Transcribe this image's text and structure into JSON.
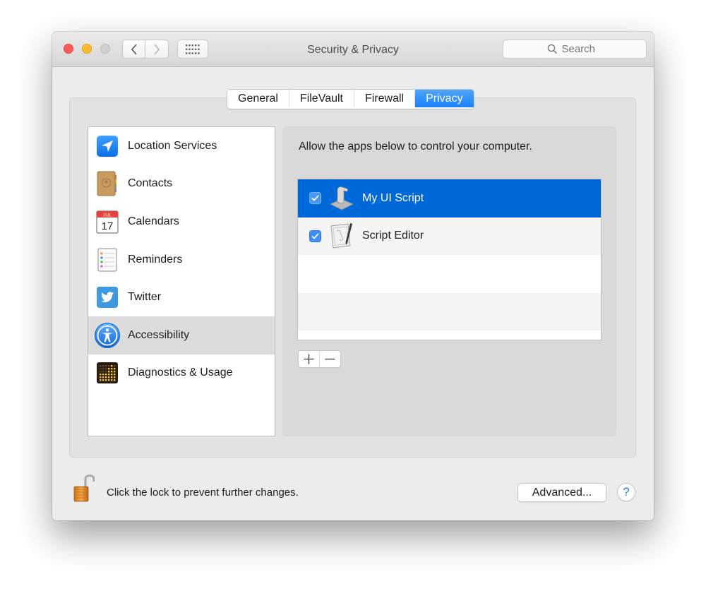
{
  "window": {
    "title": "Security & Privacy",
    "search_placeholder": "Search"
  },
  "tabs": [
    {
      "label": "General",
      "active": false
    },
    {
      "label": "FileVault",
      "active": false
    },
    {
      "label": "Firewall",
      "active": false
    },
    {
      "label": "Privacy",
      "active": true
    }
  ],
  "sidebar": {
    "items": [
      {
        "label": "Location Services",
        "icon": "location-arrow-icon",
        "selected": false
      },
      {
        "label": "Contacts",
        "icon": "contacts-book-icon",
        "selected": false
      },
      {
        "label": "Calendars",
        "icon": "calendar-icon",
        "selected": false,
        "icon_month": "JUL",
        "icon_day": "17"
      },
      {
        "label": "Reminders",
        "icon": "reminders-list-icon",
        "selected": false
      },
      {
        "label": "Twitter",
        "icon": "twitter-bird-icon",
        "selected": false
      },
      {
        "label": "Accessibility",
        "icon": "accessibility-figure-icon",
        "selected": true
      },
      {
        "label": "Diagnostics & Usage",
        "icon": "diagnostics-grid-icon",
        "selected": false
      }
    ]
  },
  "panel": {
    "description": "Allow the apps below to control your computer.",
    "apps": [
      {
        "name": "My UI Script",
        "checked": true,
        "selected": true,
        "icon": "script-scroll-icon"
      },
      {
        "name": "Script Editor",
        "checked": true,
        "selected": false,
        "icon": "script-editor-icon"
      }
    ],
    "add_label": "+",
    "remove_label": "−"
  },
  "footer": {
    "lock_text": "Click the lock to prevent further changes.",
    "lock_state": "unlocked",
    "advanced_label": "Advanced...",
    "help_label": "?"
  },
  "colors": {
    "accent": "#1a82f9",
    "selection": "#0069d9",
    "checkbox": "#3d8ef7",
    "close": "#fc5b57",
    "minimize": "#fdbb2e"
  }
}
